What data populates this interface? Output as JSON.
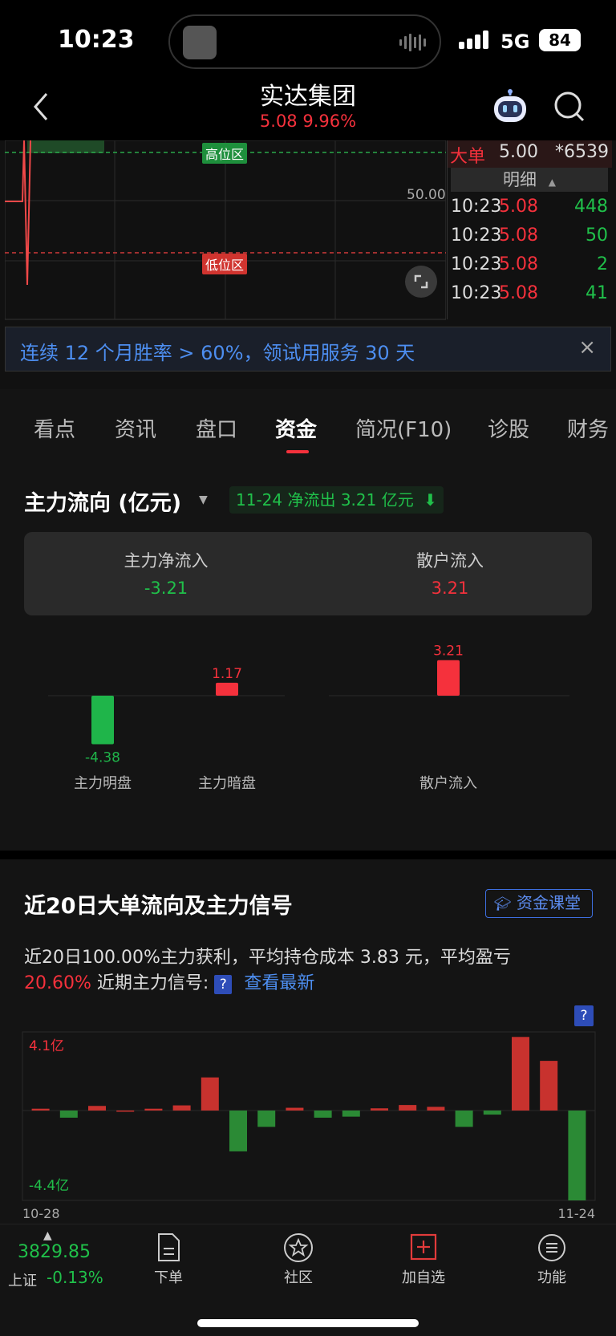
{
  "status_bar": {
    "time": "10:23",
    "network": "5G",
    "battery": "84"
  },
  "header": {
    "stock_name": "实达集团",
    "price": "5.08",
    "change_pct": "9.96%"
  },
  "intraday": {
    "high_zone_label": "高位区",
    "low_zone_label": "低位区",
    "mid_price_label": "50.00",
    "big_order": {
      "label": "大单",
      "price": "5.00",
      "volume": "*6539"
    },
    "detail_header": "明细",
    "trades": [
      {
        "time": "10:23",
        "price": "5.08",
        "volume": "448"
      },
      {
        "time": "10:23",
        "price": "5.08",
        "volume": "50"
      },
      {
        "time": "10:23",
        "price": "5.08",
        "volume": "2"
      },
      {
        "time": "10:23",
        "price": "5.08",
        "volume": "41"
      }
    ]
  },
  "promo_banner": {
    "text": "连续 12 个月胜率 > 60%，领试用服务 30 天"
  },
  "tabs": [
    {
      "label": "看点"
    },
    {
      "label": "资讯"
    },
    {
      "label": "盘口"
    },
    {
      "label": "资金"
    },
    {
      "label": "简况(F10)"
    },
    {
      "label": "诊股"
    },
    {
      "label": "财务"
    }
  ],
  "active_tab": "资金",
  "main_flow": {
    "title": "主力流向 (亿元)",
    "badge": "11-24 净流出 3.21 亿元",
    "net_inflow_label": "主力净流入",
    "net_inflow_value": "-3.21",
    "retail_inflow_label": "散户流入",
    "retail_inflow_value": "3.21"
  },
  "chart_data": [
    {
      "type": "bar",
      "categories": [
        "主力明盘",
        "主力暗盘",
        "散户流入"
      ],
      "values": [
        -4.38,
        1.17,
        3.21
      ],
      "value_labels": [
        "-4.38",
        "1.17",
        "3.21"
      ],
      "colors": {
        "positive": "#f5313c",
        "negative": "#1fb54a"
      }
    },
    {
      "type": "bar",
      "title": "近20日大单流向及主力信号",
      "x_start_label": "10-28",
      "x_end_label": "11-24",
      "y_max_label": "4.1亿",
      "y_min_label": "-4.4亿",
      "ylim": [
        -4.4,
        4.1
      ],
      "values": [
        0.1,
        -0.35,
        0.25,
        0.0,
        0.1,
        0.28,
        1.8,
        -2.0,
        -0.8,
        0.15,
        -0.35,
        -0.3,
        0.12,
        0.3,
        0.2,
        -0.8,
        -0.2,
        4.0,
        2.7,
        -4.4
      ],
      "colors": {
        "positive": "#c8322e",
        "negative": "#2b8a35"
      }
    }
  ],
  "flow20": {
    "title": "近20日大单流向及主力信号",
    "class_button": "资金课堂",
    "summary_line1": "近20日100.00%主力获利，平均持仓成本 3.83 元，平均盈亏",
    "summary_pct": "20.60%",
    "summary_signal_label": "近期主力信号:",
    "see_latest": "查看最新"
  },
  "bottom_nav": {
    "index_value": "3829.85",
    "index_name": "上证",
    "index_change": "-0.13%",
    "items": [
      {
        "label": "下单",
        "icon": "order-doc-icon"
      },
      {
        "label": "社区",
        "icon": "community-star-icon"
      },
      {
        "label": "加自选",
        "icon": "add-watchlist-icon"
      },
      {
        "label": "功能",
        "icon": "menu-icon"
      }
    ]
  }
}
